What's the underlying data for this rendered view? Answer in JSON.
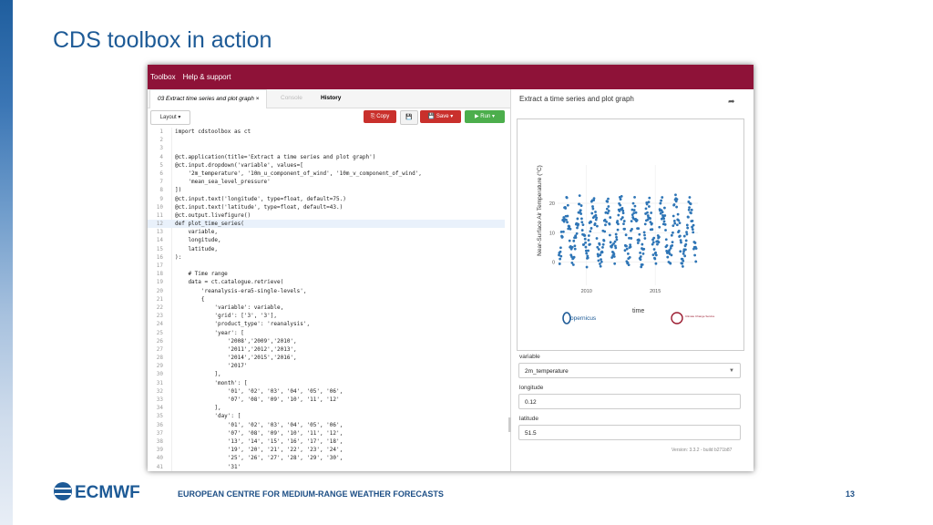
{
  "slide": {
    "title": "CDS toolbox in action",
    "footer": "EUROPEAN CENTRE FOR MEDIUM-RANGE WEATHER FORECASTS",
    "page_number": "13",
    "logo_text": "ECMWF"
  },
  "app": {
    "menu": [
      "Toolbox",
      "Help & support"
    ],
    "tabs": [
      "03 Extract time series and plot graph ×",
      "Console",
      "History"
    ],
    "toolbar": {
      "layout": "Layout ▾",
      "copy": "⎘ Copy",
      "disk": "💾",
      "save": "💾 Save ▾",
      "run": "▶ Run ▾"
    },
    "code_lines": [
      "import cdstoolbox as ct",
      "",
      "",
      "@ct.application(title='Extract a time series and plot graph')",
      "@ct.input.dropdown('variable', values=[",
      "    '2m_temperature', '10m_u_component_of_wind', '10m_v_component_of_wind',",
      "    'mean_sea_level_pressure'",
      "])",
      "@ct.input.text('longitude', type=float, default=75.)",
      "@ct.input.text('latitude', type=float, default=43.)",
      "@ct.output.livefigure()",
      "def plot_time_series(",
      "    variable,",
      "    longitude,",
      "    latitude,",
      "):",
      "",
      "    # Time range",
      "    data = ct.catalogue.retrieve(",
      "        'reanalysis-era5-single-levels',",
      "        {",
      "            'variable': variable,",
      "            'grid': ['3', '3'],",
      "            'product_type': 'reanalysis',",
      "            'year': [",
      "                '2008','2009','2010',",
      "                '2011','2012','2013',",
      "                '2014','2015','2016',",
      "                '2017'",
      "            ],",
      "            'month': [",
      "                '01', '02', '03', '04', '05', '06',",
      "                '07', '08', '09', '10', '11', '12'",
      "            ],",
      "            'day': [",
      "                '01', '02', '03', '04', '05', '06',",
      "                '07', '08', '09', '10', '11', '12',",
      "                '13', '14', '15', '16', '17', '18',",
      "                '19', '20', '21', '22', '23', '24',",
      "                '25', '26', '27', '28', '29', '30',",
      "                '31'"
    ],
    "highlight_line": 12
  },
  "output": {
    "title": "Extract a time series and plot graph",
    "logo_left": "opernicus",
    "logo_right": "Climate Change Service",
    "variable_label": "variable",
    "variable_value": "2m_temperature",
    "longitude_label": "longitude",
    "longitude_value": "0.12",
    "latitude_label": "latitude",
    "latitude_value": "51.5",
    "version": "Version: 3.3.2 - build b271b87"
  },
  "chart_data": {
    "type": "scatter",
    "title": "",
    "xlabel": "time",
    "ylabel": "Near-Surface Air Temperature (°C)",
    "x_ticks": [
      2010,
      2015
    ],
    "y_ticks": [
      0,
      10,
      20
    ],
    "xlim": [
      2007.9,
      2018.1
    ],
    "ylim": [
      -6,
      33
    ],
    "color": "#2e75b6",
    "series": [
      {
        "x_start": 2008,
        "x_end": 2018,
        "points_per_year": 40,
        "seasonal_mean": 10.5,
        "seasonal_amplitude": 8,
        "peak_month": 7,
        "noise": 4.5
      }
    ]
  }
}
